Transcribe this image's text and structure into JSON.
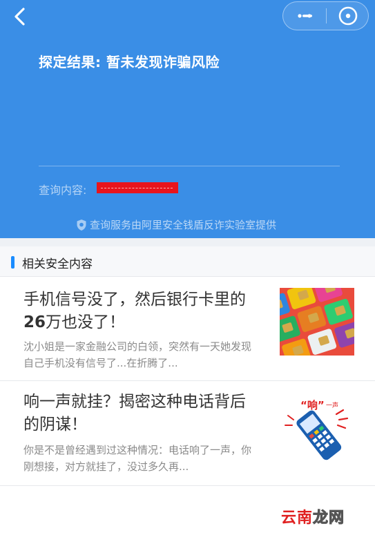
{
  "nav": {
    "back_icon": "chevron-left-icon",
    "more_icon": "more-dots-icon",
    "close_icon": "close-miniprogram-icon"
  },
  "result": {
    "title": "探定结果: 暂未发现诈骗风险",
    "query_label": "查询内容:",
    "provider_text": "查询服务由阿里安全钱盾反诈实验室提供"
  },
  "section": {
    "title": "相关安全内容"
  },
  "articles": [
    {
      "title_a": "手机信号没了，然后银行卡里的",
      "title_b_bold": "26",
      "title_b_rest": "万也没了！",
      "description": "沈小姐是一家金融公司的白领，突然有一天她发现自己手机没有信号了...在折腾了...",
      "thumbnail": "sim-cards-image"
    },
    {
      "title_a": "响一声就挂？揭密这种电话背后",
      "title_b_bold": "",
      "title_b_rest": "的阴谋！",
      "description": "你是不是曾经遇到过这种情况：电话响了一声，你刚想接，对方就挂了，没过多久再...",
      "thumbnail": "ringing-phone-image",
      "thumbnail_text_main": "“响”",
      "thumbnail_text_sub": "一声"
    }
  ],
  "watermark": {
    "part1": "云南",
    "part2": "龙网"
  },
  "colors": {
    "header_bg": "#3a8ee6",
    "accent_bar": "#1a8cff",
    "redaction": "#e8141c"
  }
}
